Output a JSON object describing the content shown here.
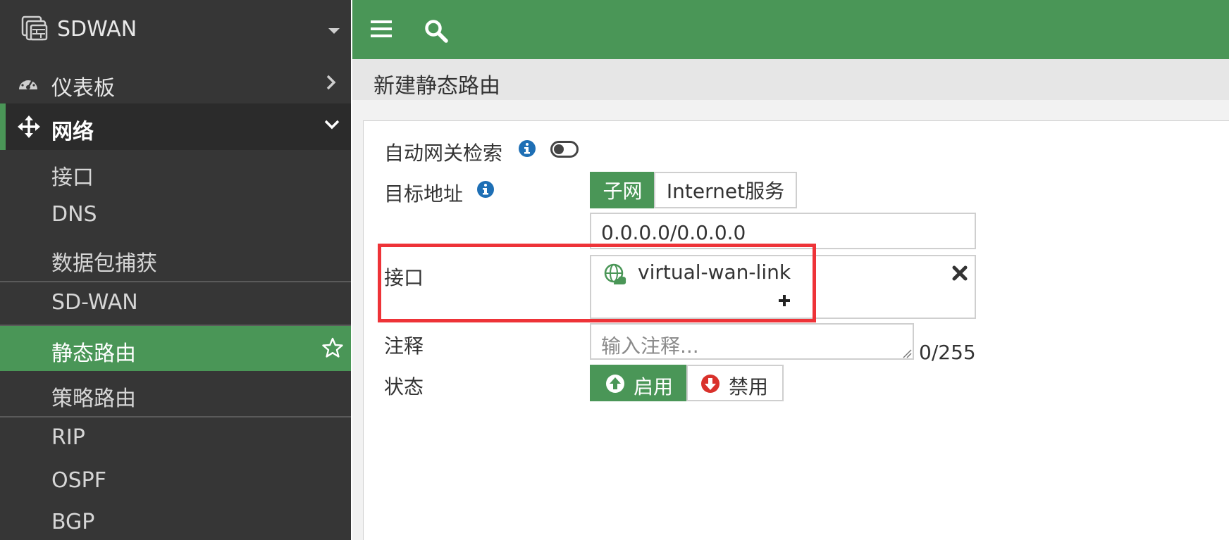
{
  "brand": {
    "name": "SDWAN",
    "icon": "firewall-device-icon"
  },
  "sidebar": {
    "dashboard": {
      "label": "仪表板",
      "icon": "gauge-icon"
    },
    "network": {
      "label": "网络",
      "icon": "move-arrows-icon",
      "items": [
        {
          "label": "接口"
        },
        {
          "label": "DNS"
        },
        {
          "label": "数据包捕获"
        },
        {
          "label": "SD-WAN"
        },
        {
          "label": "静态路由",
          "active": true
        },
        {
          "label": "策略路由"
        },
        {
          "label": "RIP"
        },
        {
          "label": "OSPF"
        },
        {
          "label": "BGP"
        }
      ]
    }
  },
  "page": {
    "title": "新建静态路由"
  },
  "form": {
    "auto_gateway": {
      "label": "自动网关检索",
      "enabled": false
    },
    "destination": {
      "label": "目标地址",
      "options": [
        "子网",
        "Internet服务"
      ],
      "selected": "子网",
      "value": "0.0.0.0/0.0.0.0"
    },
    "interface": {
      "label": "接口",
      "value": "virtual-wan-link",
      "add_symbol": "+"
    },
    "comment": {
      "label": "注释",
      "placeholder": "输入注释...",
      "counter": "0/255"
    },
    "status": {
      "label": "状态",
      "enable_label": "启用",
      "disable_label": "禁用",
      "selected": "启用"
    }
  },
  "colors": {
    "accent": "#4a9657",
    "highlight": "#ee3338",
    "sidebar_bg": "#363636",
    "info": "#1e6fb5",
    "disable": "#d9312b"
  }
}
